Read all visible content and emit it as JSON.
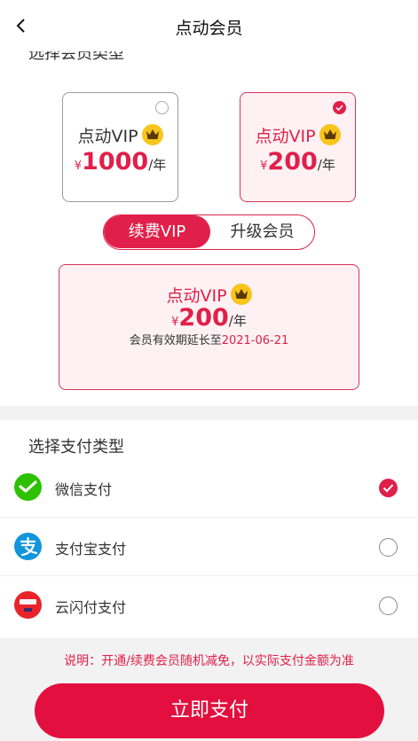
{
  "header": {
    "title": "点动会员",
    "back_icon": "chevron-left-icon"
  },
  "membership": {
    "section_title": "选择会员类型",
    "plans": [
      {
        "name": "点动VIP",
        "currency": "¥",
        "price": "1000",
        "period": "/年",
        "selected": false
      },
      {
        "name": "点动VIP",
        "currency": "¥",
        "price": "200",
        "period": "/年",
        "selected": true
      }
    ],
    "toggle": {
      "active": "续费VIP",
      "inactive": "升级会员"
    },
    "summary": {
      "name": "点动VIP",
      "currency": "¥",
      "price": "200",
      "period": "/年",
      "validity_text": "会员有效期延长至",
      "validity_date": "2021-06-21"
    }
  },
  "payment": {
    "section_title": "选择支付类型",
    "methods": [
      {
        "label": "微信支付",
        "icon": "wechat-pay-icon",
        "selected": true
      },
      {
        "label": "支付宝支付",
        "icon": "alipay-icon",
        "selected": false
      },
      {
        "label": "云闪付支付",
        "icon": "unionpay-quickpass-icon",
        "selected": false
      }
    ]
  },
  "note": "说明：开通/续费会员随机减免，以实际支付金额为准",
  "pay_button": "立即支付",
  "colors": {
    "accent": "#e0204a",
    "button": "#e3103f",
    "selected_bg": "#fdf1f3",
    "crown": "#f7c51b",
    "wechat": "#2dc100",
    "alipay": "#1296db",
    "unionpay": "#e8242a"
  }
}
